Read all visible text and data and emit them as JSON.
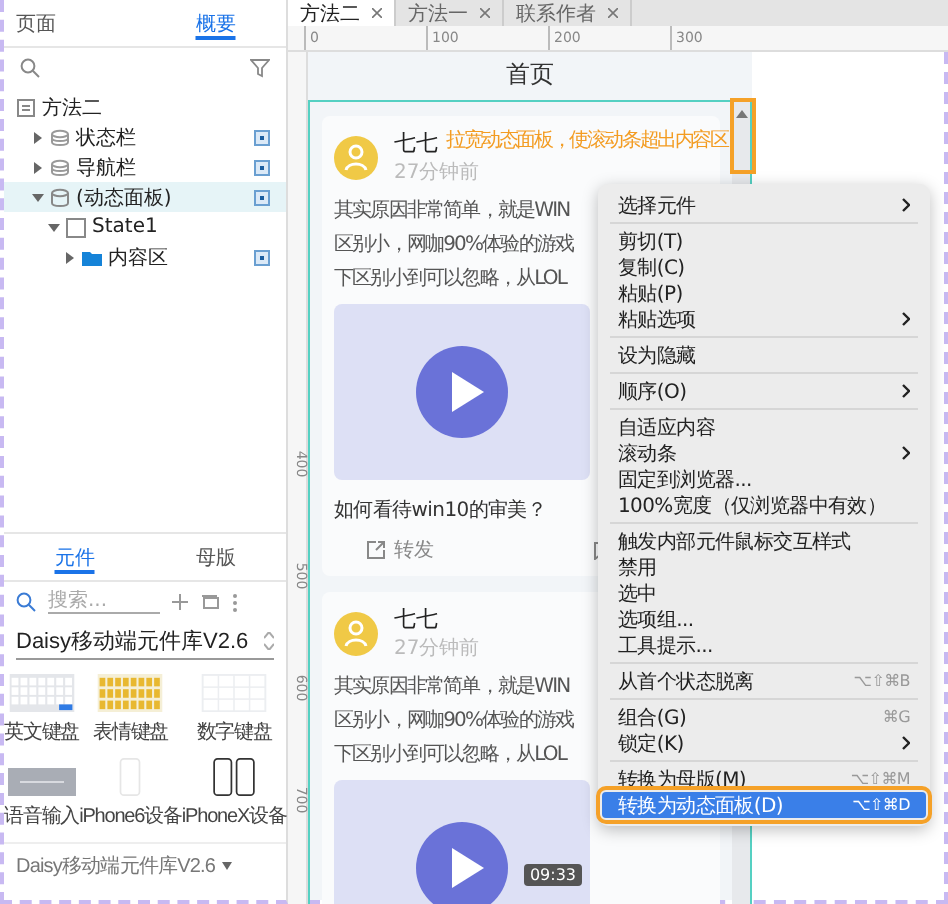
{
  "left_panel": {
    "tabs": [
      {
        "label": "页面",
        "selected": false
      },
      {
        "label": "概要",
        "selected": true
      }
    ],
    "outline": [
      {
        "label": "方法二",
        "kind": "page",
        "selected": false,
        "children": [
          {
            "label": "状态栏",
            "kind": "group",
            "expanded": false,
            "selected": false
          },
          {
            "label": "导航栏",
            "kind": "group",
            "expanded": false,
            "selected": false
          },
          {
            "label": "(动态面板)",
            "kind": "dynamic",
            "expanded": true,
            "selected": true,
            "children": [
              {
                "label": "State1",
                "kind": "state",
                "expanded": true,
                "selected": false,
                "children": [
                  {
                    "label": "内容区",
                    "kind": "folder",
                    "expanded": false,
                    "selected": false
                  }
                ]
              }
            ]
          }
        ]
      }
    ],
    "widget_tabs": [
      {
        "label": "元件",
        "selected": true
      },
      {
        "label": "母版",
        "selected": false
      }
    ],
    "search": {
      "placeholder": "搜索..."
    },
    "library": "Daisy移动端元件库V2.6",
    "widgets": [
      {
        "label": "英文键盘",
        "kind": "keyboard"
      },
      {
        "label": "表情键盘",
        "kind": "emoji"
      },
      {
        "label": "数字键盘",
        "kind": "numpad"
      },
      {
        "label": "语音输入",
        "kind": "voice"
      },
      {
        "label": "iPhone6设备",
        "kind": "iphone6"
      },
      {
        "label": "iPhoneX设备",
        "kind": "iphonex"
      }
    ],
    "footer": "Daisy移动端元件库V2.6"
  },
  "document_tabs": [
    {
      "label": "方法二",
      "selected": true
    },
    {
      "label": "方法一",
      "selected": false
    },
    {
      "label": "联系作者",
      "selected": false
    }
  ],
  "ruler": {
    "horizontal": [
      "0",
      "100",
      "200",
      "300"
    ],
    "vertical": [
      "400",
      "500",
      "600",
      "700"
    ]
  },
  "page": {
    "title": "首页",
    "annotation": "拉宽动态面板，使滚动条超出内容区",
    "posts": [
      {
        "author": "七七",
        "time": "27分钟前",
        "lines": [
          "其实原因非常简单，就是WIN",
          "区别小，网咖90%体验的游戏",
          "下区别小到可以忽略，从LOL"
        ],
        "question": "如何看待win10的审美？",
        "share": "转发"
      },
      {
        "author": "七七",
        "time": "27分钟前",
        "lines": [
          "其实原因非常简单，就是WIN",
          "区别小，网咖90%体验的游戏",
          "下区别小到可以忽略，从LOL"
        ],
        "duration": "09:33"
      }
    ]
  },
  "context_menu": [
    {
      "kind": "item",
      "label": "选择元件",
      "submenu": true,
      "selected": false
    },
    {
      "kind": "separator"
    },
    {
      "kind": "item",
      "label": "剪切(T)",
      "submenu": false,
      "selected": false
    },
    {
      "kind": "item",
      "label": "复制(C)",
      "submenu": false,
      "selected": false
    },
    {
      "kind": "item",
      "label": "粘贴(P)",
      "submenu": false,
      "selected": false
    },
    {
      "kind": "item",
      "label": "粘贴选项",
      "submenu": true,
      "selected": false
    },
    {
      "kind": "separator"
    },
    {
      "kind": "item",
      "label": "设为隐藏",
      "submenu": false,
      "selected": false
    },
    {
      "kind": "separator"
    },
    {
      "kind": "item",
      "label": "顺序(O)",
      "submenu": true,
      "selected": false
    },
    {
      "kind": "separator"
    },
    {
      "kind": "item",
      "label": "自适应内容",
      "submenu": false,
      "selected": false
    },
    {
      "kind": "item",
      "label": "滚动条",
      "submenu": true,
      "selected": false
    },
    {
      "kind": "item",
      "label": "固定到浏览器...",
      "submenu": false,
      "selected": false
    },
    {
      "kind": "item",
      "label": "100%宽度（仅浏览器中有效）",
      "submenu": false,
      "selected": false
    },
    {
      "kind": "separator"
    },
    {
      "kind": "item",
      "label": "触发内部元件鼠标交互样式",
      "submenu": false,
      "selected": false
    },
    {
      "kind": "item",
      "label": "禁用",
      "submenu": false,
      "selected": false
    },
    {
      "kind": "item",
      "label": "选中",
      "submenu": false,
      "selected": false
    },
    {
      "kind": "item",
      "label": "选项组...",
      "submenu": false,
      "selected": false
    },
    {
      "kind": "item",
      "label": "工具提示...",
      "submenu": false,
      "selected": false
    },
    {
      "kind": "separator"
    },
    {
      "kind": "item",
      "label": "从首个状态脱离",
      "shortcut": "⌥⇧⌘B",
      "submenu": false,
      "selected": false
    },
    {
      "kind": "separator"
    },
    {
      "kind": "item",
      "label": "组合(G)",
      "shortcut": "⌘G",
      "submenu": false,
      "selected": false
    },
    {
      "kind": "item",
      "label": "锁定(K)",
      "submenu": true,
      "selected": false
    },
    {
      "kind": "separator"
    },
    {
      "kind": "item",
      "label": "转换为母版(M)",
      "shortcut": "⌥⇧⌘M",
      "submenu": false,
      "selected": false
    },
    {
      "kind": "item",
      "label": "转换为动态面板(D)",
      "shortcut": "⌥⇧⌘D",
      "submenu": false,
      "selected": true
    }
  ]
}
